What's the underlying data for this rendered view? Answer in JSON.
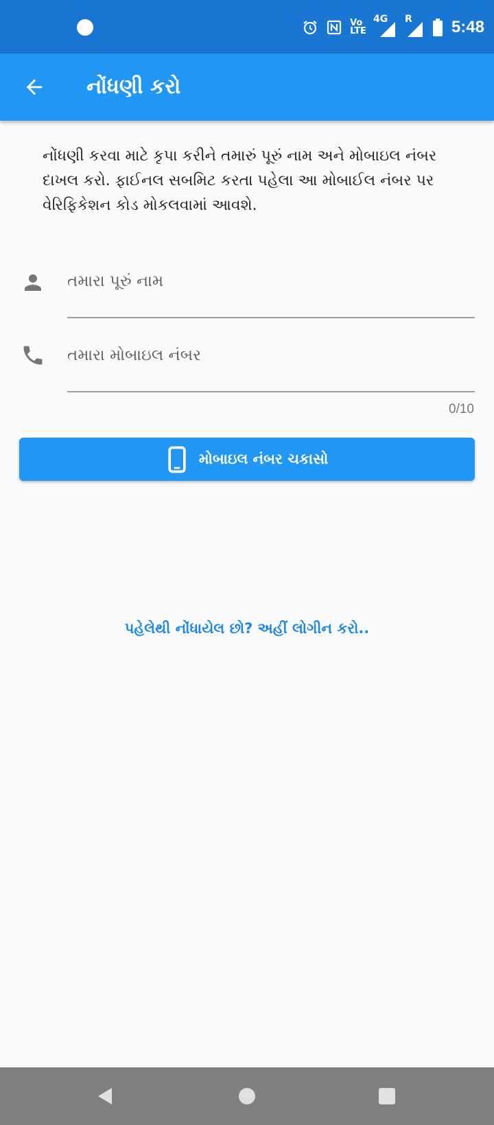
{
  "status_bar": {
    "time": "5:48",
    "volte_top": "Vo",
    "volte_bottom": "LTE",
    "network": "4G",
    "roaming": "R",
    "icons": [
      "alarm-icon",
      "nfc-icon",
      "volte-icon",
      "signal-icon",
      "roaming-signal-icon",
      "battery-icon"
    ]
  },
  "app_bar": {
    "title": "નોંધણી કરો",
    "back_icon": "arrow-back-icon"
  },
  "intro": {
    "text": "નોંધણી કરવા માટે કૃપા કરીને તમારું પૂરું નામ અને મોબાઇલ નંબર દાખલ કરો. ફાઈનલ સબમિટ કરતા પહેલા આ મોબાઈલ નંબર પર વેરિફિકેશન કોડ મોકલવામાં આવશે."
  },
  "form": {
    "name_field": {
      "icon": "person-icon",
      "placeholder": "તમારા પૂરું નામ",
      "value": ""
    },
    "mobile_field": {
      "icon": "phone-icon",
      "placeholder": "તમારા મોબાઇલ નંબર",
      "value": "",
      "counter": "0/10"
    },
    "verify_button": {
      "icon": "smartphone-icon",
      "label": "મોબાઇલ નંબર ચકાસો",
      "color": "#2196f3"
    }
  },
  "login_link": {
    "text": "પહેલેથી નોંધાયેલ છો? અહીં લોગીન કરો..",
    "color": "#1e88e5"
  },
  "nav_bar": {
    "icons": [
      "nav-back-icon",
      "nav-home-icon",
      "nav-recents-icon"
    ]
  },
  "colors": {
    "status_bar": "#1976d2",
    "app_bar": "#2196f3",
    "background": "#fafafa",
    "nav_bar": "#808080"
  }
}
